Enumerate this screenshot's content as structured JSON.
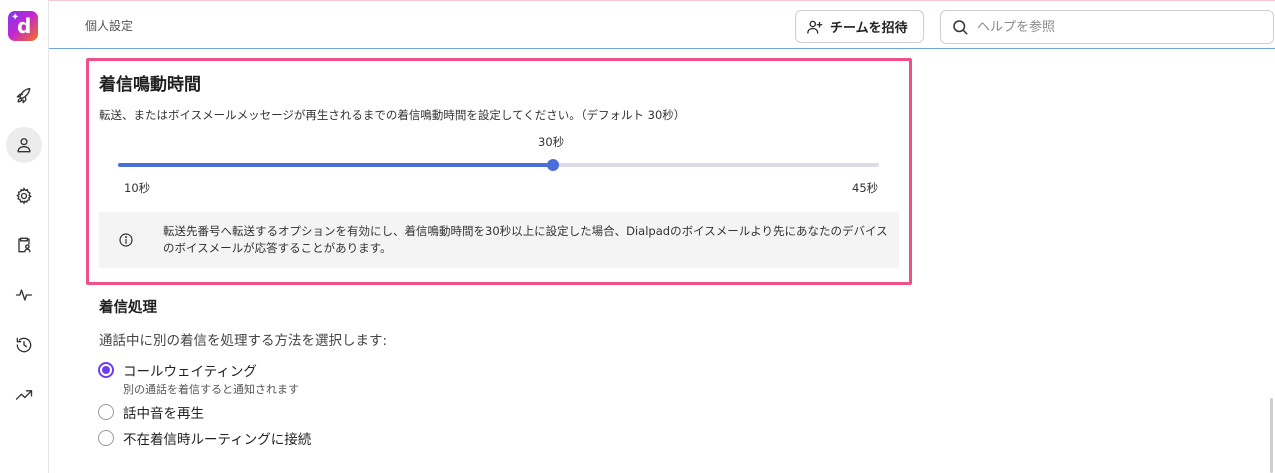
{
  "header": {
    "page_title": "個人設定",
    "invite_label": "チームを招待",
    "search_placeholder": "ヘルプを参照"
  },
  "sidebar": {
    "logo_letter": "d",
    "items": [
      {
        "icon": "rocket-icon",
        "active": false
      },
      {
        "icon": "person-icon",
        "active": true
      },
      {
        "icon": "gear-icon",
        "active": false
      },
      {
        "icon": "clipboard-person-icon",
        "active": false
      },
      {
        "icon": "activity-icon",
        "active": false
      },
      {
        "icon": "history-icon",
        "active": false
      },
      {
        "icon": "trending-up-icon",
        "active": false
      }
    ]
  },
  "ring_duration": {
    "title": "着信鳴動時間",
    "description": "転送、またはボイスメールメッセージが再生されるまでの着信鳴動時間を設定してください。（デフォルト 30秒）",
    "slider": {
      "value_label": "30秒",
      "min_label": "10秒",
      "max_label": "45秒",
      "min": 10,
      "max": 45,
      "value": 30
    },
    "info_text": "転送先番号へ転送するオプションを有効にし、着信鳴動時間を30秒以上に設定した場合、Dialpadのボイスメールより先にあなたのデバイスのボイスメールが応答することがあります。"
  },
  "incoming_handling": {
    "title": "着信処理",
    "description": "通話中に別の着信を処理する方法を選択します:",
    "options": [
      {
        "label": "コールウェイティング",
        "sublabel": "別の通話を着信すると通知されます",
        "checked": true
      },
      {
        "label": "話中音を再生",
        "checked": false
      },
      {
        "label": "不在着信時ルーティングに接続",
        "checked": false
      }
    ]
  },
  "colors": {
    "accent": "#4a6fd8",
    "highlight_border": "#f0508a",
    "radio_checked": "#6d3df5"
  }
}
